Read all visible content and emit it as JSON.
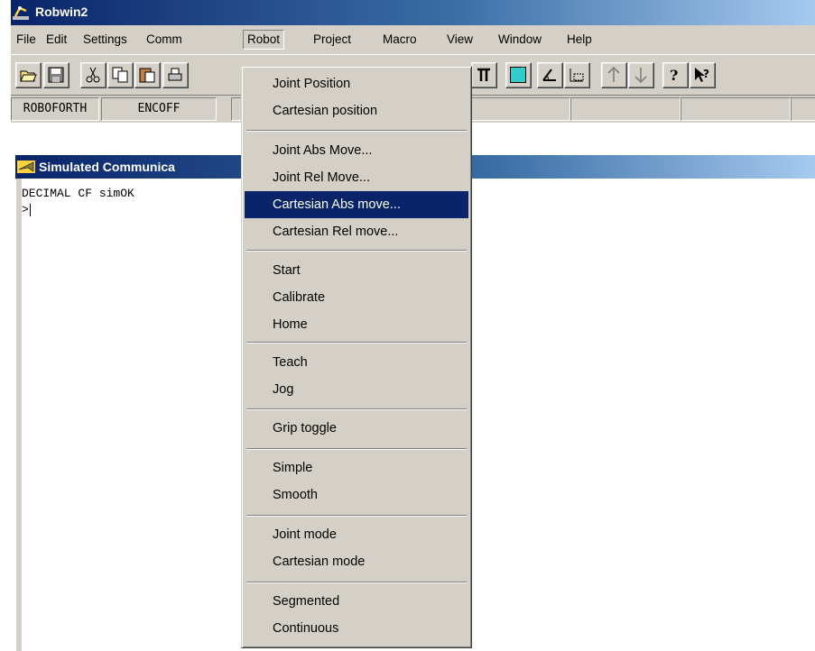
{
  "window": {
    "title": "Robwin2",
    "icon": "robot-arm-icon"
  },
  "menubar": {
    "items": [
      "File",
      "Edit",
      "Settings",
      "Comm",
      "Robot",
      "Project",
      "Macro",
      "View",
      "Window",
      "Help"
    ],
    "open_menu": "Robot"
  },
  "toolbar": {
    "buttons": [
      "open-folder-icon",
      "save-icon",
      "cut-icon",
      "copy-icon",
      "paste-icon",
      "print-icon",
      "gripper-icon",
      "color-square-icon",
      "angle-icon",
      "frame-icon",
      "arrow-up-icon",
      "arrow-down-icon",
      "about-help-icon",
      "context-help-icon"
    ]
  },
  "status": {
    "panels": [
      "ROBOFORTH",
      "ENCOFF",
      "",
      "",
      "",
      "",
      "",
      ""
    ]
  },
  "child": {
    "title": "Simulated Communica",
    "console_lines": [
      "DECIMAL CF simOK",
      ">"
    ]
  },
  "robot_menu": {
    "groups": [
      [
        "Joint Position",
        "Cartesian position"
      ],
      [
        "Joint Abs Move...",
        "Joint Rel Move...",
        "Cartesian Abs move...",
        "Cartesian Rel move..."
      ],
      [
        "Start",
        "Calibrate",
        "Home"
      ],
      [
        "Teach",
        "Jog"
      ],
      [
        "Grip toggle"
      ],
      [
        "Simple",
        "Smooth"
      ],
      [
        "Joint mode",
        "Cartesian mode"
      ],
      [
        "Segmented",
        "Continuous"
      ]
    ],
    "highlighted": "Cartesian Abs move..."
  },
  "colors": {
    "title_active": "#0a246a",
    "face": "#d4d0c8",
    "highlight": "#0a246a",
    "cyan": "#33cccc"
  }
}
